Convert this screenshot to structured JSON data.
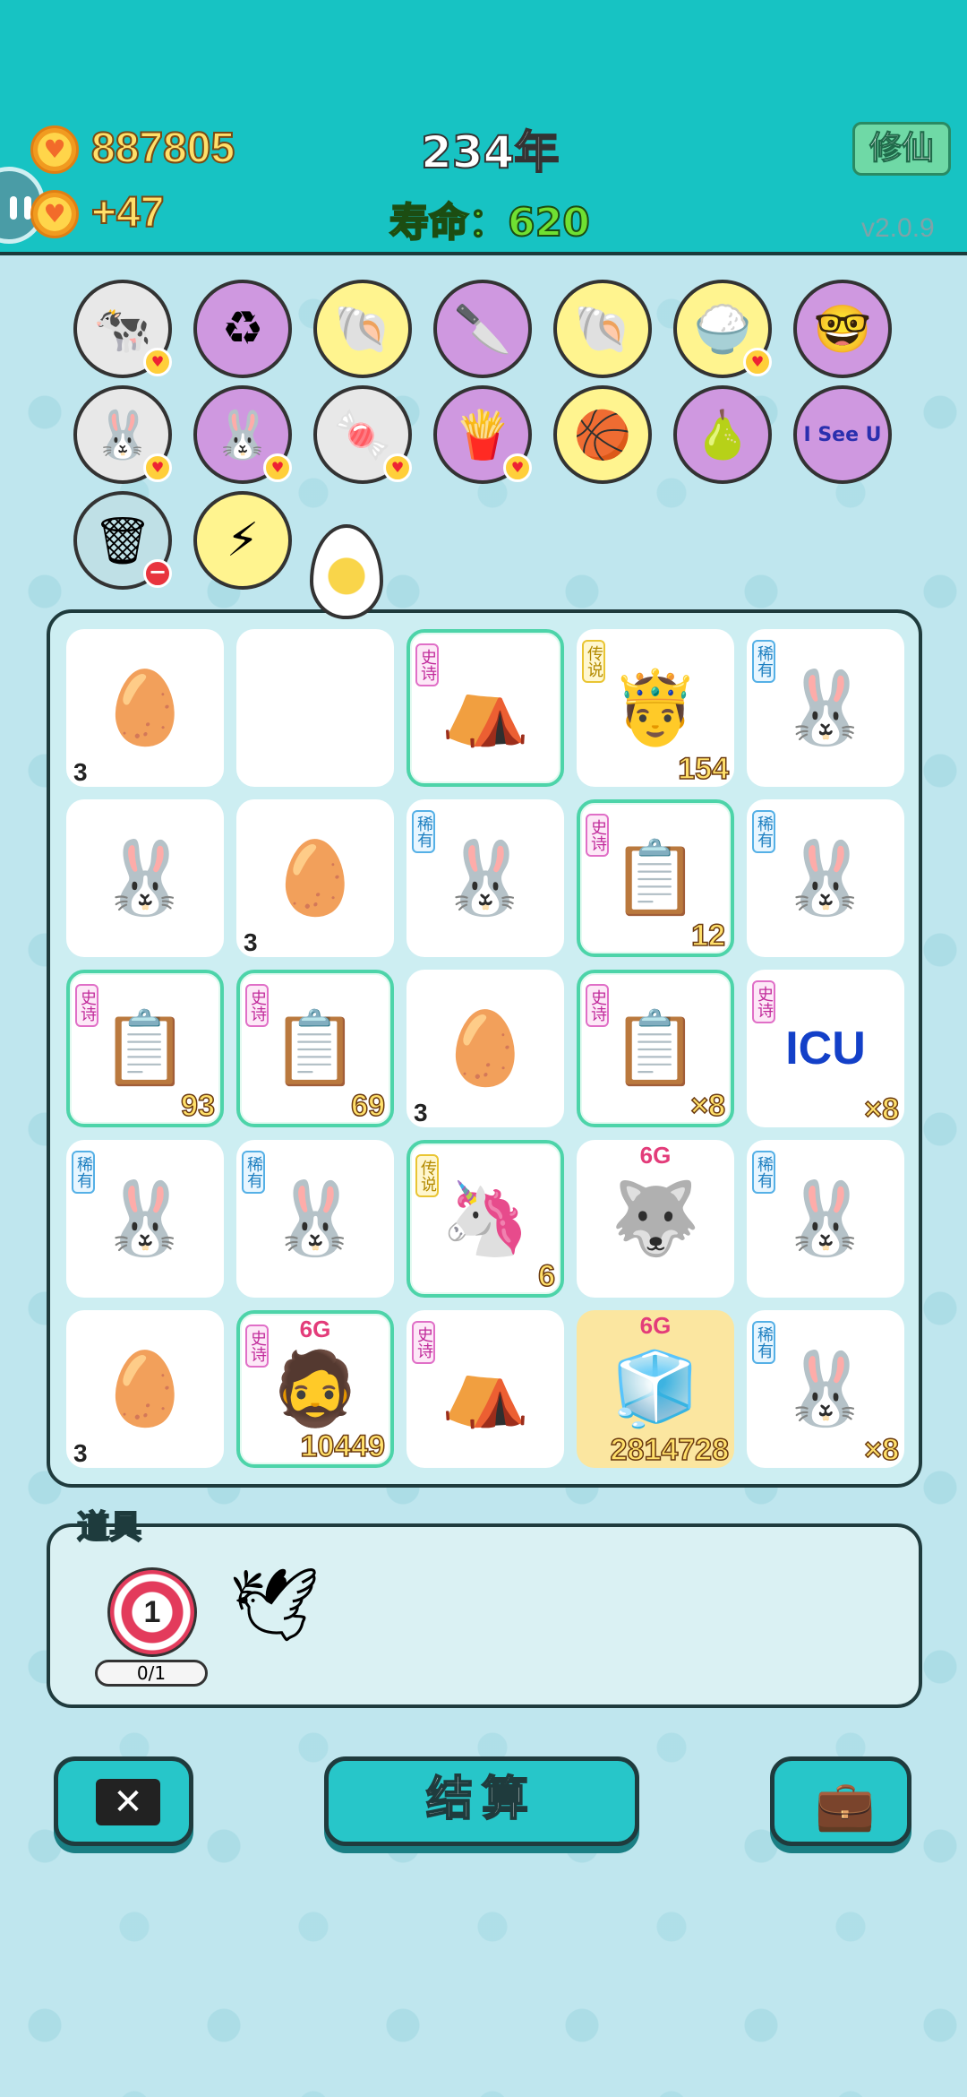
{
  "header": {
    "money": "887805",
    "income": "+47",
    "year": "234年",
    "life": "寿命：620",
    "xiuxian_label": "修仙",
    "version": "v2.0.9"
  },
  "symbols": [
    {
      "icon": "🐄",
      "bg": "#e8e8e8"
    },
    {
      "icon": "♻",
      "bg": "#cf98e0"
    },
    {
      "icon": "🐚",
      "bg": "#fff48f"
    },
    {
      "icon": "🔪",
      "bg": "#cf98e0"
    },
    {
      "icon": "🐚",
      "bg": "#fff48f"
    },
    {
      "icon": "🍚",
      "bg": "#fff48f"
    },
    {
      "icon": "🤓",
      "bg": "#cf98e0"
    },
    {
      "icon": "🐰",
      "bg": "#e8e8e8"
    },
    {
      "icon": "🐰",
      "bg": "#cf98e0"
    },
    {
      "icon": "🍬",
      "bg": "#e8e8e8"
    },
    {
      "icon": "🍟",
      "bg": "#cf98e0"
    },
    {
      "icon": "🏀",
      "bg": "#fff48f"
    },
    {
      "icon": "🍐",
      "bg": "#cf98e0"
    },
    {
      "icon": "I See U",
      "bg": "#cf98e0"
    },
    {
      "icon": "🗑",
      "bg": "#bfe0e6"
    },
    {
      "icon": "⚡",
      "bg": "#fff48f"
    }
  ],
  "grid": [
    [
      {
        "icon": "🥚",
        "count": "3",
        "count_pos": "left",
        "rarity": "",
        "style": ""
      },
      {
        "icon": "",
        "count": "",
        "count_pos": "",
        "rarity": "",
        "style": ""
      },
      {
        "icon": "⛺",
        "count": "",
        "count_pos": "",
        "rarity": "史诗",
        "style": "epic"
      },
      {
        "icon": "🤴",
        "count": "154",
        "count_pos": "right",
        "rarity": "传说",
        "style": ""
      },
      {
        "icon": "🐰",
        "count": "",
        "count_pos": "",
        "rarity": "稀有",
        "style": ""
      }
    ],
    [
      {
        "icon": "🐰",
        "count": "",
        "count_pos": "",
        "rarity": "",
        "style": ""
      },
      {
        "icon": "🥚",
        "count": "3",
        "count_pos": "left",
        "rarity": "",
        "style": ""
      },
      {
        "icon": "🐰",
        "count": "",
        "count_pos": "",
        "rarity": "稀有",
        "style": ""
      },
      {
        "icon": "📋",
        "count": "12",
        "count_pos": "right",
        "rarity": "史诗",
        "style": "epic"
      },
      {
        "icon": "🐰",
        "count": "",
        "count_pos": "",
        "rarity": "稀有",
        "style": ""
      }
    ],
    [
      {
        "icon": "📋",
        "count": "93",
        "count_pos": "right",
        "rarity": "史诗",
        "style": "epic"
      },
      {
        "icon": "📋",
        "count": "69",
        "count_pos": "right",
        "rarity": "史诗",
        "style": "epic"
      },
      {
        "icon": "🥚",
        "count": "3",
        "count_pos": "left",
        "rarity": "",
        "style": ""
      },
      {
        "icon": "📋",
        "count": "×8",
        "count_pos": "right",
        "rarity": "史诗",
        "style": "epic"
      },
      {
        "icon": "ICU",
        "count": "×8",
        "count_pos": "right",
        "rarity": "史诗",
        "style": ""
      }
    ],
    [
      {
        "icon": "🐰",
        "count": "",
        "count_pos": "",
        "rarity": "稀有",
        "style": ""
      },
      {
        "icon": "🐰",
        "count": "",
        "count_pos": "",
        "rarity": "稀有",
        "style": ""
      },
      {
        "icon": "🦄",
        "count": "6",
        "count_pos": "right",
        "rarity": "传说",
        "style": "epic"
      },
      {
        "icon": "🐺",
        "count": "",
        "count_pos": "",
        "rarity": "",
        "style": "",
        "tag": "6G"
      },
      {
        "icon": "🐰",
        "count": "",
        "count_pos": "",
        "rarity": "稀有",
        "style": ""
      }
    ],
    [
      {
        "icon": "🥚",
        "count": "3",
        "count_pos": "left",
        "rarity": "",
        "style": ""
      },
      {
        "icon": "🧔",
        "count": "10449",
        "count_pos": "right",
        "rarity": "史诗",
        "style": "epic",
        "tag": "6G"
      },
      {
        "icon": "⛺",
        "count": "",
        "count_pos": "",
        "rarity": "史诗",
        "style": ""
      },
      {
        "icon": "🧊",
        "count": "2814728",
        "count_pos": "right",
        "rarity": "",
        "style": "gold",
        "tag": "6G"
      },
      {
        "icon": "🐰",
        "count": "×8",
        "count_pos": "right",
        "rarity": "稀有",
        "style": ""
      }
    ]
  ],
  "props": {
    "label": "道具",
    "target_value": "1",
    "target_count": "0/1"
  },
  "buttons": {
    "settle_label": "结算"
  }
}
